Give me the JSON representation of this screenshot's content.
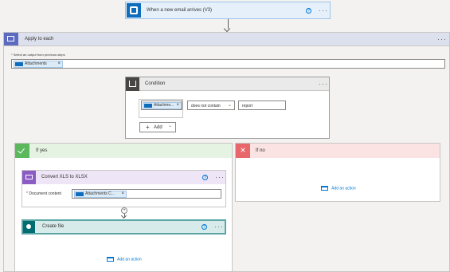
{
  "trigger": {
    "title": "When a new email arrives (V3)"
  },
  "apply_to_each": {
    "title": "Apply to each",
    "select_label": "Select an output from previous steps",
    "required_mark": "*",
    "token": "Attachments"
  },
  "condition": {
    "title": "Condition",
    "left_token": "Attachme...",
    "operator": "does not contain",
    "value": "report",
    "add_label": "Add"
  },
  "if_yes": {
    "title": "If yes",
    "convert": {
      "title": "Convert XLS to XLSX",
      "field_label": "Document content",
      "required_mark": "*",
      "token": "Attachments C..."
    },
    "create_file": {
      "title": "Create file"
    },
    "add_action": "Add an action"
  },
  "if_no": {
    "title": "If no",
    "add_action": "Add an action"
  },
  "colors": {
    "outlook": "#0f6cbd",
    "loop": "#5c6bc0",
    "condition": "#484644",
    "yes": "#5cb85c",
    "no": "#e8676b",
    "encodian": "#8b5cc4",
    "sharepoint": "#036c70"
  },
  "icons": [
    "outlook-icon",
    "loop-icon",
    "condition-icon",
    "check-icon",
    "close-icon",
    "encodian-icon",
    "sharepoint-icon",
    "help-icon",
    "more-icon",
    "add-action-icon",
    "plus-icon",
    "chevron-down-icon"
  ]
}
